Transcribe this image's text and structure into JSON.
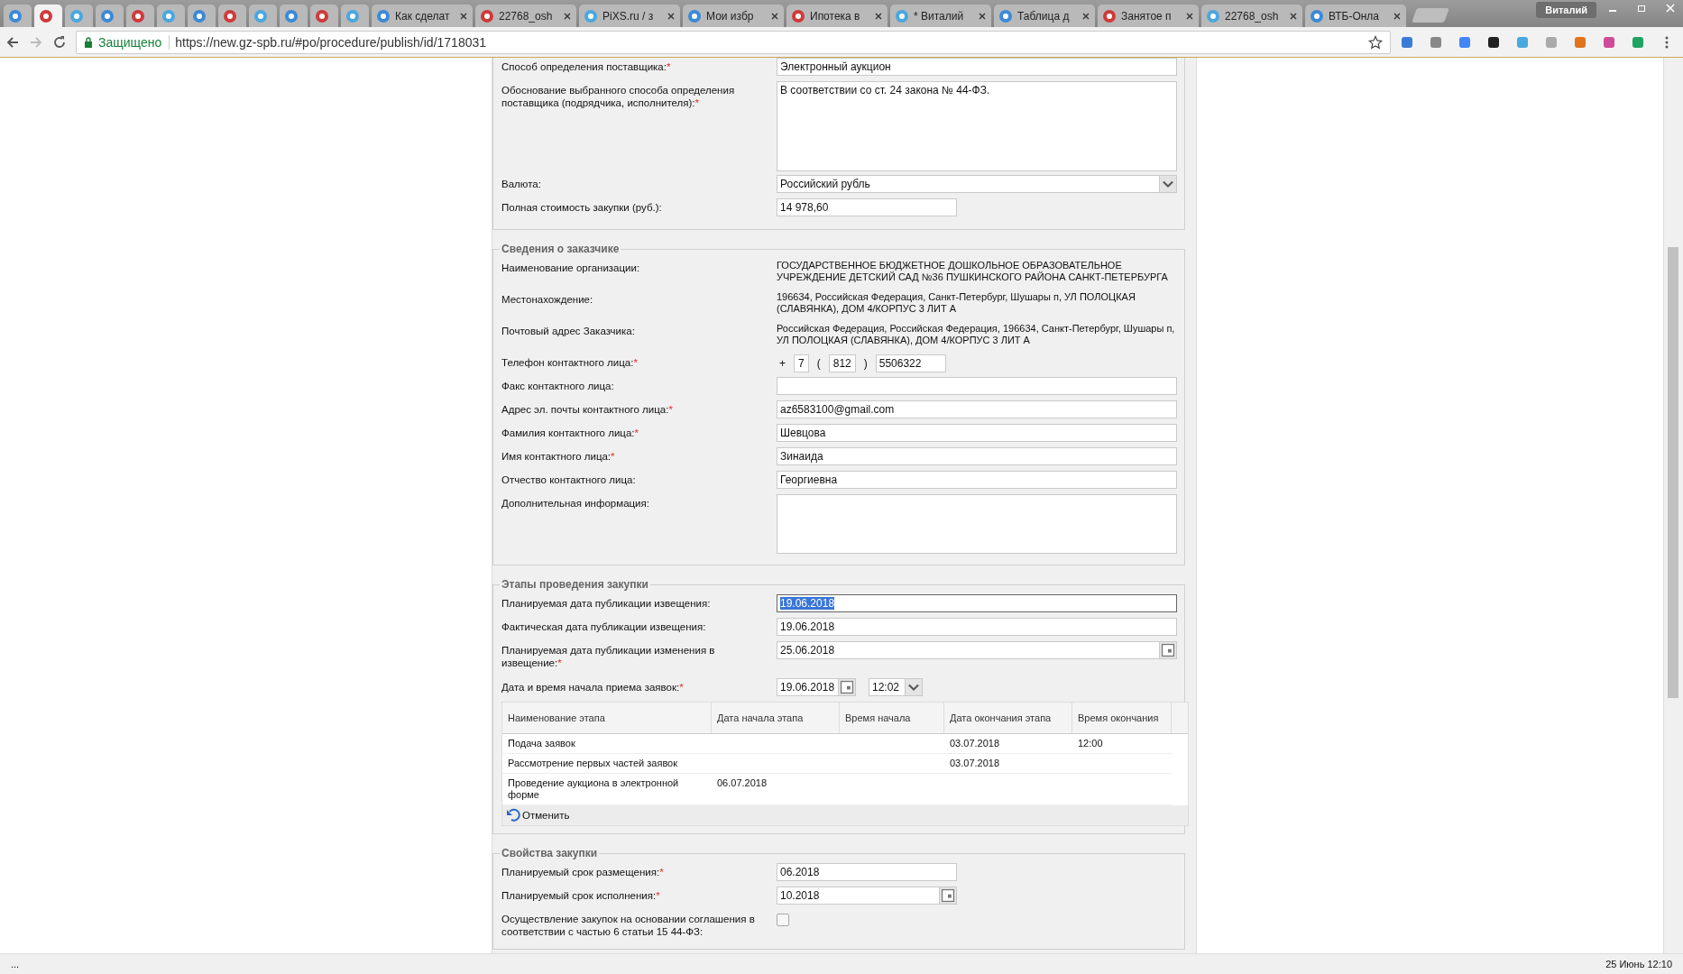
{
  "browser": {
    "tabs": [
      {
        "selected": false
      },
      {
        "selected": true
      },
      {
        "selected": false
      },
      {
        "selected": false
      },
      {
        "selected": false
      },
      {
        "selected": false
      },
      {
        "selected": false
      },
      {
        "selected": false
      },
      {
        "selected": false
      },
      {
        "selected": false
      },
      {
        "selected": false
      },
      {
        "selected": false
      },
      {
        "title": "Как сделат",
        "selected": false
      },
      {
        "title": "22768_osh",
        "selected": false
      },
      {
        "title": "PiXS.ru / з",
        "selected": false
      },
      {
        "title": "Мои избр",
        "selected": false
      },
      {
        "title": "Ипотека в",
        "selected": false
      },
      {
        "title": "* Виталий",
        "selected": false
      },
      {
        "title": "Таблица д",
        "selected": false
      },
      {
        "title": "Занятое п",
        "selected": false
      },
      {
        "title": "22768_osh",
        "selected": false
      },
      {
        "title": "ВТБ-Онла",
        "selected": false
      }
    ],
    "profile": "Виталий",
    "security": "Защищено",
    "url": "https://new.gz-spb.ru/#po/procedure/publish/id/1718031"
  },
  "sections": [
    {
      "rows": [
        {
          "kind": "input",
          "label": "Способ определения поставщика:",
          "required_mark": "*",
          "value": "Электронный аукцион"
        },
        {
          "kind": "textarea",
          "label": "Обоснование выбранного способа определения поставщика (подрядчика, исполнителя):",
          "required_mark": "*",
          "value": "В соответствии со ст. 24 закона  № 44-ФЗ."
        },
        {
          "kind": "select",
          "label": "Валюта:",
          "value": "Российский рубль"
        },
        {
          "kind": "short",
          "label": "Полная стоимость закупки (руб.):",
          "value": "14 978,60"
        }
      ]
    },
    {
      "legend": "Сведения о заказчике",
      "rows": [
        {
          "kind": "text",
          "label": "Наименование организации:",
          "value": "ГОСУДАРСТВЕННОЕ БЮДЖЕТНОЕ ДОШКОЛЬНОЕ ОБРАЗОВАТЕЛЬНОЕ УЧРЕЖДЕНИЕ ДЕТСКИЙ САД №36 ПУШКИНСКОГО РАЙОНА САНКТ-ПЕТЕРБУРГА"
        },
        {
          "kind": "text",
          "label": "Местонахождение:",
          "value": "196634, Российская Федерация, Санкт-Петербург, Шушары п, УЛ ПОЛОЦКАЯ (СЛАВЯНКА), ДОМ 4/КОРПУС 3 ЛИТ А"
        },
        {
          "kind": "text",
          "label": "Почтовый адрес Заказчика:",
          "value": "Российская Федерация, Российская Федерация, 196634, Санкт-Петербург, Шушары п, УЛ ПОЛОЦКАЯ (СЛАВЯНКА), ДОМ 4/КОРПУС 3 ЛИТ А"
        },
        {
          "kind": "phone",
          "label": "Телефон контактного лица:",
          "required_mark": "*",
          "parts": [
            "+",
            "7",
            "(",
            "812",
            ")",
            "5506322"
          ]
        },
        {
          "kind": "input",
          "label": "Факс контактного лица:"
        },
        {
          "kind": "input",
          "label": "Адрес эл. почты контактного лица:",
          "required_mark": "*",
          "value": "az6583100@gmail.com"
        },
        {
          "kind": "input",
          "label": "Фамилия контактного лица:",
          "required_mark": "*",
          "value": "Шевцова"
        },
        {
          "kind": "input",
          "label": "Имя контактного лица:",
          "required_mark": "*",
          "value": "Зинаида"
        },
        {
          "kind": "input",
          "label": "Отчество контактного лица:",
          "value": "Георгиевна"
        },
        {
          "kind": "textarea",
          "label": "Дополнительная информация:"
        }
      ]
    },
    {
      "legend": "Этапы проведения закупки",
      "rows": [
        {
          "kind": "input",
          "label": "Планируемая дата публикации извещения:",
          "value": "19.06.2018",
          "text_selected": true
        },
        {
          "kind": "input",
          "label": "Фактическая дата публикации извещения:",
          "value": "19.06.2018",
          "text_selected": false
        },
        {
          "kind": "date",
          "label": "Планируемая дата публикации изменения в извещение:",
          "required_mark": "*",
          "value": "25.06.2018"
        },
        {
          "kind": "datetime",
          "label": "Дата и время начала приема заявок:",
          "required_mark": "*",
          "value": "19.06.2018",
          "time": "12:02"
        }
      ],
      "table": {
        "columns": [
          "Наименование этапа",
          "Дата начала этапа",
          "Время начала",
          "Дата окончания этапа",
          "Время окончания"
        ],
        "rows": [
          [
            "Подача заявок",
            "",
            "",
            "03.07.2018",
            "12:00"
          ],
          [
            "Рассмотрение первых частей заявок",
            "",
            "",
            "03.07.2018",
            ""
          ],
          [
            "Проведение аукциона в электронной форме",
            "06.07.2018",
            "",
            "",
            ""
          ]
        ],
        "action": "Отменить"
      }
    },
    {
      "legend": "Свойства закупки",
      "rows": [
        {
          "kind": "short",
          "label": "Планируемый срок размещения:",
          "required_mark": "*",
          "value": "06.2018"
        },
        {
          "kind": "shortdate",
          "label": "Планируемый срок исполнения:",
          "required_mark": "*",
          "value": "10.2018"
        },
        {
          "kind": "checkbox",
          "label": "Осуществление закупок на основании соглашения в соответствии с частью 6 статьи 15 44-ФЗ:",
          "checked": false
        }
      ]
    }
  ],
  "status": {
    "left": "...",
    "right": "25 Июнь 12:10"
  }
}
